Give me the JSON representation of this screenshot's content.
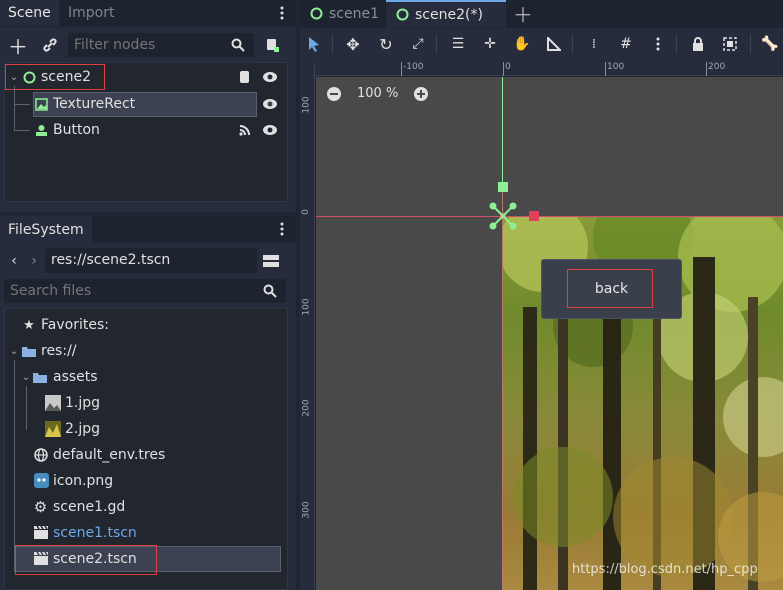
{
  "scene_dock": {
    "tabs": [
      {
        "label": "Scene",
        "active": true
      },
      {
        "label": "Import",
        "active": false
      }
    ],
    "filter_placeholder": "Filter nodes",
    "nodes": [
      {
        "label": "scene2",
        "icon": "node2d-icon"
      },
      {
        "label": "TextureRect",
        "icon": "texture-rect-icon"
      },
      {
        "label": "Button",
        "icon": "button-icon"
      }
    ]
  },
  "filesystem_dock": {
    "tab_label": "FileSystem",
    "path_value": "res://scene2.tscn",
    "search_placeholder": "Search files",
    "favorites_label": "Favorites:",
    "root_label": "res://",
    "items": [
      {
        "label": "assets",
        "icon": "folder-icon"
      },
      {
        "label": "1.jpg",
        "icon": "image-thumb-icon"
      },
      {
        "label": "2.jpg",
        "icon": "image-thumb-icon"
      },
      {
        "label": "default_env.tres",
        "icon": "globe-icon"
      },
      {
        "label": "icon.png",
        "icon": "godot-icon"
      },
      {
        "label": "scene1.gd",
        "icon": "gear-icon"
      },
      {
        "label": "scene1.tscn",
        "icon": "clapper-icon"
      },
      {
        "label": "scene2.tscn",
        "icon": "clapper-icon"
      }
    ]
  },
  "editor_tabs": [
    {
      "label": "scene1",
      "active": false
    },
    {
      "label": "scene2(*)",
      "active": true
    }
  ],
  "viewport": {
    "zoom_label": "100 %",
    "ruler_h": [
      "-100",
      "0",
      "100",
      "200"
    ],
    "ruler_v": [
      "100",
      "0",
      "100",
      "200",
      "300"
    ],
    "button_label": "back"
  },
  "watermark": "https://blog.csdn.net/hp_cpp",
  "colors": {
    "accent": "#6ea8e6",
    "selection_box": "#e0403f",
    "node_icon": "#8eef97",
    "scene_link": "#6ea8e6",
    "canvas_bg": "#494949"
  }
}
